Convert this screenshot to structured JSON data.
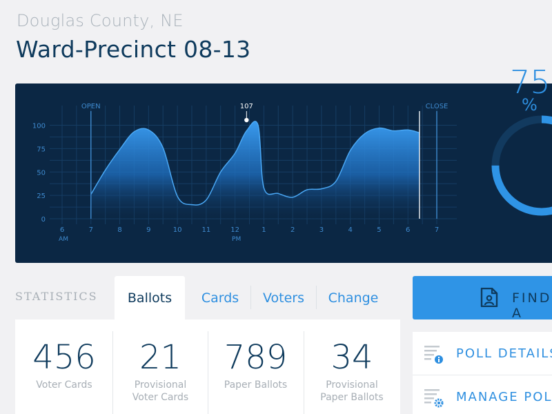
{
  "location": {
    "county": "Douglas County, NE",
    "precinct": "Ward-Precinct 08-13"
  },
  "chart_data": {
    "type": "area",
    "markers": {
      "open": "OPEN",
      "close": "CLOSE",
      "peak_label": "107"
    },
    "y_ticks": [
      "100",
      "75",
      "50",
      "25",
      "0"
    ],
    "x_ticks": [
      {
        "label": "6",
        "sub": "AM"
      },
      {
        "label": "7",
        "sub": ""
      },
      {
        "label": "8",
        "sub": ""
      },
      {
        "label": "9",
        "sub": ""
      },
      {
        "label": "10",
        "sub": ""
      },
      {
        "label": "11",
        "sub": ""
      },
      {
        "label": "12",
        "sub": "PM"
      },
      {
        "label": "1",
        "sub": ""
      },
      {
        "label": "2",
        "sub": ""
      },
      {
        "label": "3",
        "sub": ""
      },
      {
        "label": "4",
        "sub": ""
      },
      {
        "label": "5",
        "sub": ""
      },
      {
        "label": "6",
        "sub": ""
      },
      {
        "label": "7",
        "sub": ""
      }
    ],
    "ylim": [
      0,
      100
    ],
    "x_range_hours": [
      6,
      19
    ],
    "open_hour": 7,
    "close_hour": 19,
    "current_hour": 18.4,
    "peak": {
      "x": 12.4,
      "y": 107
    },
    "series": [
      {
        "x": [
          7,
          7.5,
          8,
          8.5,
          9,
          9.5,
          10,
          10.5,
          11,
          11.5,
          12,
          12.4,
          12.8,
          13,
          13.5,
          14,
          14.5,
          15,
          15.5,
          16,
          16.5,
          17,
          17.5,
          18,
          18.4
        ],
        "values": [
          26,
          52,
          74,
          93,
          95,
          76,
          24,
          15,
          20,
          50,
          70,
          94,
          100,
          33,
          27,
          23,
          31,
          32,
          40,
          73,
          91,
          97,
          94,
          95,
          92
        ]
      }
    ],
    "grid": true,
    "accent": "#2f94e6"
  },
  "gauge": {
    "value": "75",
    "unit": "%",
    "fraction": 0.75
  },
  "stats": {
    "label": "STATISTICS",
    "tabs": [
      "Ballots",
      "Cards",
      "Voters",
      "Change"
    ],
    "active_tab": 0,
    "items": [
      {
        "value": "456",
        "label_1": "Voter Cards",
        "label_2": ""
      },
      {
        "value": "21",
        "label_1": "Provisional",
        "label_2": "Voter Cards"
      },
      {
        "value": "789",
        "label_1": "Paper Ballots",
        "label_2": ""
      },
      {
        "value": "34",
        "label_1": "Provisional",
        "label_2": "Paper Ballots"
      }
    ]
  },
  "actions": {
    "find_label": "FIND A",
    "list": [
      {
        "label": "POLL DETAILS",
        "icon": "document-info-icon"
      },
      {
        "label": "MANAGE POL",
        "icon": "document-settings-icon"
      }
    ]
  }
}
